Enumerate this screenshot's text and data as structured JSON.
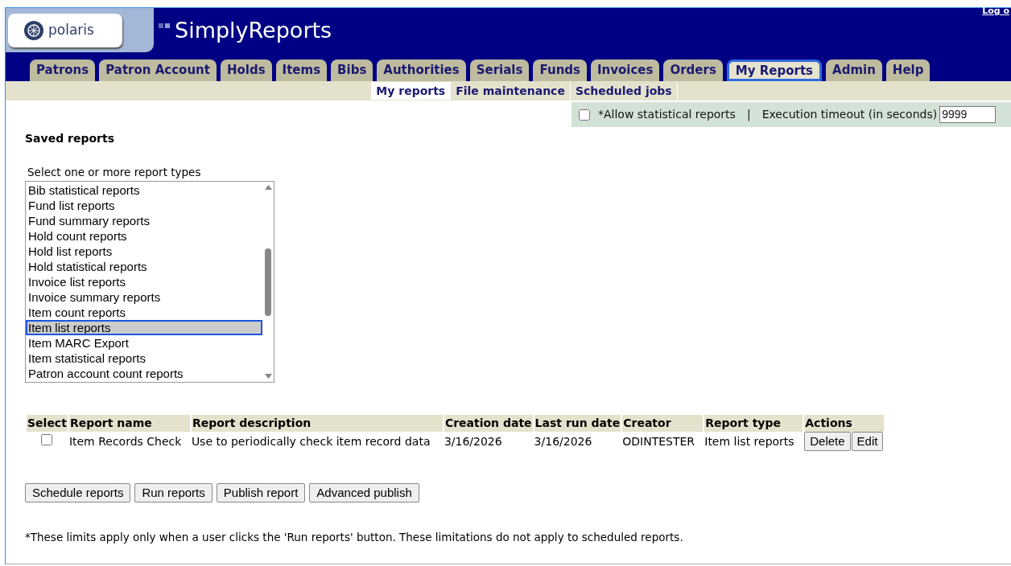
{
  "header": {
    "logo": "polaris",
    "title": "SimplyReports",
    "logout": "Log o"
  },
  "tabs": [
    {
      "label": "Patrons",
      "selected": false
    },
    {
      "label": "Patron Account",
      "selected": false
    },
    {
      "label": "Holds",
      "selected": false
    },
    {
      "label": "Items",
      "selected": false
    },
    {
      "label": "Bibs",
      "selected": false
    },
    {
      "label": "Authorities",
      "selected": false
    },
    {
      "label": "Serials",
      "selected": false
    },
    {
      "label": "Funds",
      "selected": false
    },
    {
      "label": "Invoices",
      "selected": false
    },
    {
      "label": "Orders",
      "selected": false
    },
    {
      "label": "My Reports",
      "selected": true
    },
    {
      "label": "Admin",
      "selected": false
    },
    {
      "label": "Help",
      "selected": false
    }
  ],
  "subnav": [
    {
      "label": "My reports",
      "selected": true
    },
    {
      "label": "File maintenance",
      "selected": false
    },
    {
      "label": "Scheduled jobs",
      "selected": false
    }
  ],
  "options": {
    "allow_statistical": {
      "label": "*Allow statistical reports",
      "checked": false
    },
    "separator": "|",
    "timeout_label": "Execution timeout (in seconds)",
    "timeout_value": "9999"
  },
  "saved_reports": {
    "title": "Saved reports",
    "list_label": "Select one or more report types",
    "report_types": [
      {
        "label": "Bib statistical reports",
        "selected": false
      },
      {
        "label": "Fund list reports",
        "selected": false
      },
      {
        "label": "Fund summary reports",
        "selected": false
      },
      {
        "label": "Hold count reports",
        "selected": false
      },
      {
        "label": "Hold list reports",
        "selected": false
      },
      {
        "label": "Hold statistical reports",
        "selected": false
      },
      {
        "label": "Invoice list reports",
        "selected": false
      },
      {
        "label": "Invoice summary reports",
        "selected": false
      },
      {
        "label": "Item count reports",
        "selected": false
      },
      {
        "label": "Item list reports",
        "selected": true
      },
      {
        "label": "Item MARC Export",
        "selected": false
      },
      {
        "label": "Item statistical reports",
        "selected": false
      },
      {
        "label": "Patron account count reports",
        "selected": false
      }
    ]
  },
  "table": {
    "columns": [
      "Select",
      "Report name",
      "Report description",
      "Creation date",
      "Last run date",
      "Creator",
      "Report type",
      "Actions"
    ],
    "rows": [
      {
        "checked": false,
        "name": "Item Records Check",
        "description": "Use to periodically check item record data",
        "created": "3/16/2026",
        "last_run": "3/16/2026",
        "creator": "ODINTESTER",
        "type": "Item list reports",
        "actions": [
          "Delete",
          "Edit"
        ]
      }
    ]
  },
  "buttons": [
    "Schedule reports",
    "Run reports",
    "Publish report",
    "Advanced publish"
  ],
  "footnote": "*These limits apply only when a user clicks the 'Run reports' button. These limitations do not apply to scheduled reports."
}
